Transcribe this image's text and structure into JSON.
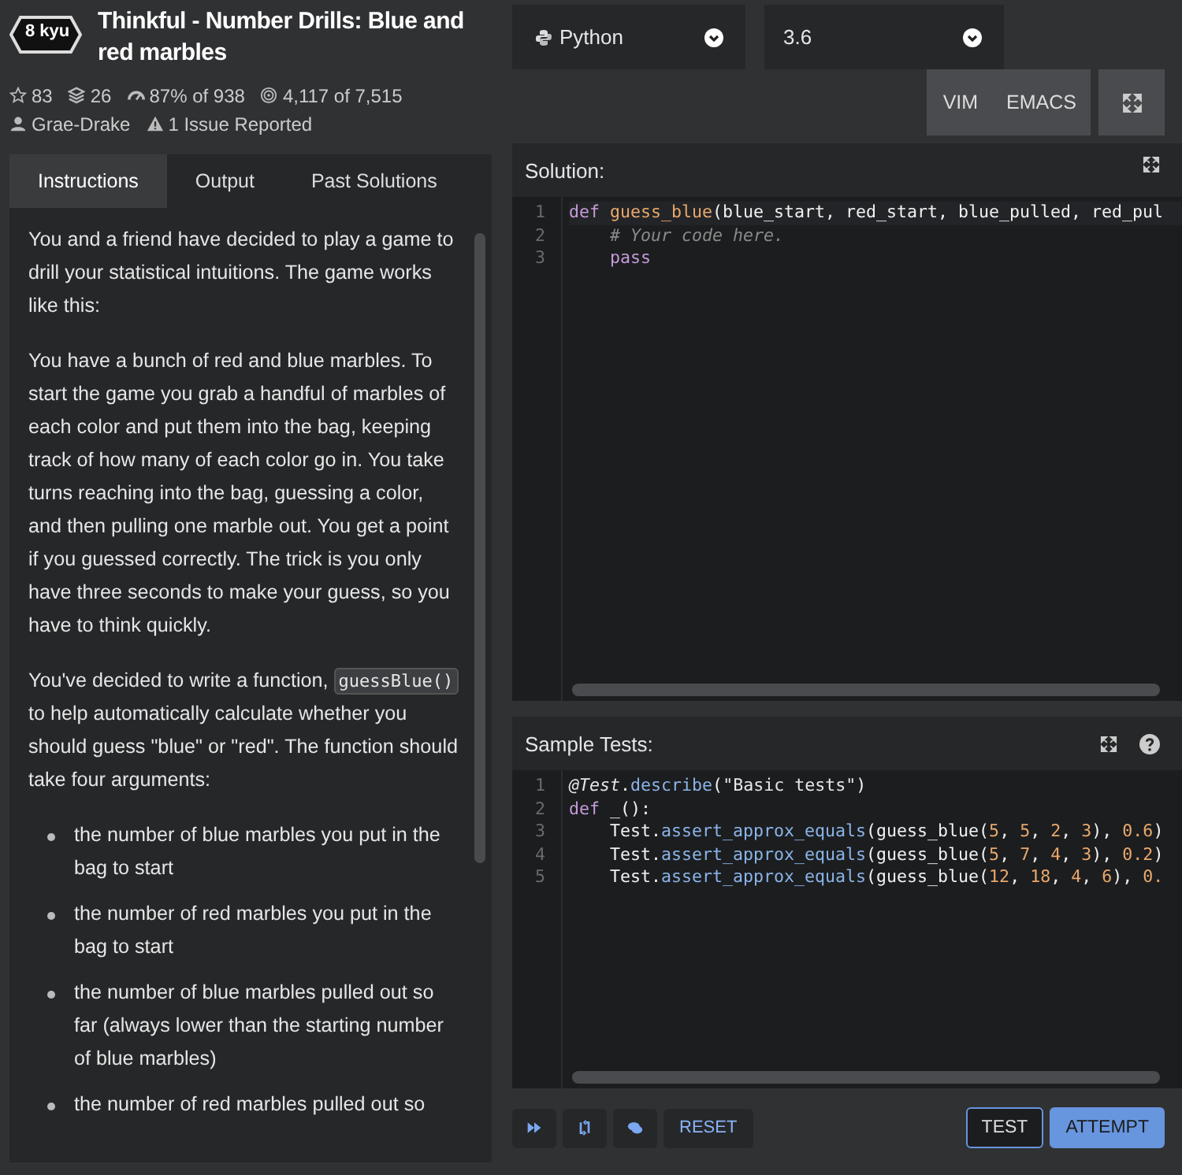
{
  "kata": {
    "rank": "8 kyu",
    "title": "Thinkful - Number Drills: Blue and red marbles",
    "stats": [
      {
        "kind": "stars",
        "text": "83"
      },
      {
        "kind": "collections",
        "text": "26"
      },
      {
        "kind": "satisfaction",
        "text": "87% of 938"
      },
      {
        "kind": "completions",
        "text": "4,117 of 7,515"
      },
      {
        "kind": "author",
        "text": "Grae-Drake"
      },
      {
        "kind": "issues",
        "text": "1 Issue Reported"
      }
    ]
  },
  "language_select": {
    "value": "Python"
  },
  "version_select": {
    "value": "3.6"
  },
  "editor_modes": [
    {
      "label": "VIM",
      "selected": false
    },
    {
      "label": "EMACS",
      "selected": false
    }
  ],
  "tabs": [
    {
      "label": "Instructions",
      "selected": true
    },
    {
      "label": "Output",
      "selected": false
    },
    {
      "label": "Past Solutions",
      "selected": false
    }
  ],
  "description": [
    {
      "kind": "paragraph",
      "parts": [
        {
          "kind": "text",
          "text": "You and a friend have decided to play a game to drill your statistical intuitions. The game works like this:"
        }
      ]
    },
    {
      "kind": "paragraph",
      "parts": [
        {
          "kind": "text",
          "text": "You have a bunch of red and blue marbles. To start the game you grab a handful of marbles of each color and put them into the bag, keeping track of how many of each color go in. You take turns reaching into the bag, guessing a color, and then pulling one marble out. You get a point if you guessed correctly. The trick is you only have three seconds to make your guess, so you have to think quickly."
        }
      ]
    },
    {
      "kind": "paragraph",
      "parts": [
        {
          "kind": "text",
          "text": "You've decided to write a function, "
        },
        {
          "kind": "code",
          "text": "guessBlue()"
        },
        {
          "kind": "text",
          "text": " to help automatically calculate whether you should guess \"blue\" or \"red\". The function should take four arguments:"
        }
      ]
    },
    {
      "kind": "bullet",
      "parts": [
        {
          "kind": "text",
          "text": "the number of blue marbles you put in the bag to start"
        }
      ]
    },
    {
      "kind": "bullet",
      "parts": [
        {
          "kind": "text",
          "text": "the number of red marbles you put in the bag to start"
        }
      ]
    },
    {
      "kind": "bullet",
      "parts": [
        {
          "kind": "text",
          "text": "the number of blue marbles pulled out so far (always lower than the starting number of blue marbles)"
        }
      ]
    },
    {
      "kind": "bullet",
      "parts": [
        {
          "kind": "text",
          "text": "the number of red marbles pulled out so"
        }
      ]
    }
  ],
  "solution": {
    "title": "Solution:",
    "lines": [
      {
        "number": "1",
        "tokens": [
          {
            "kind": "keyword",
            "text": "def "
          },
          {
            "kind": "function",
            "text": "guess_blue"
          },
          {
            "kind": "plain",
            "text": "(blue_start, red_start, blue_pulled, red_pul"
          }
        ]
      },
      {
        "number": "2",
        "tokens": [
          {
            "kind": "comment",
            "text": "    # Your code here."
          }
        ]
      },
      {
        "number": "3",
        "tokens": [
          {
            "kind": "keyword",
            "text": "    pass"
          }
        ]
      }
    ]
  },
  "sample_tests": {
    "title": "Sample Tests:",
    "lines": [
      {
        "number": "1",
        "tokens": [
          {
            "kind": "decorator",
            "text": "@Test"
          },
          {
            "kind": "plain",
            "text": "."
          },
          {
            "kind": "method",
            "text": "describe"
          },
          {
            "kind": "plain",
            "text": "("
          },
          {
            "kind": "string",
            "text": "\"Basic tests\""
          },
          {
            "kind": "plain",
            "text": ")"
          }
        ]
      },
      {
        "number": "2",
        "tokens": [
          {
            "kind": "keyword",
            "text": "def "
          },
          {
            "kind": "plain",
            "text": "_():"
          }
        ]
      },
      {
        "number": "3",
        "tokens": [
          {
            "kind": "plain",
            "text": "    Test."
          },
          {
            "kind": "method",
            "text": "assert_approx_equals"
          },
          {
            "kind": "plain",
            "text": "(guess_blue("
          },
          {
            "kind": "number",
            "text": "5"
          },
          {
            "kind": "plain",
            "text": ", "
          },
          {
            "kind": "number",
            "text": "5"
          },
          {
            "kind": "plain",
            "text": ", "
          },
          {
            "kind": "number",
            "text": "2"
          },
          {
            "kind": "plain",
            "text": ", "
          },
          {
            "kind": "number",
            "text": "3"
          },
          {
            "kind": "plain",
            "text": "), "
          },
          {
            "kind": "number",
            "text": "0.6"
          },
          {
            "kind": "plain",
            "text": ")"
          }
        ]
      },
      {
        "number": "4",
        "tokens": [
          {
            "kind": "plain",
            "text": "    Test."
          },
          {
            "kind": "method",
            "text": "assert_approx_equals"
          },
          {
            "kind": "plain",
            "text": "(guess_blue("
          },
          {
            "kind": "number",
            "text": "5"
          },
          {
            "kind": "plain",
            "text": ", "
          },
          {
            "kind": "number",
            "text": "7"
          },
          {
            "kind": "plain",
            "text": ", "
          },
          {
            "kind": "number",
            "text": "4"
          },
          {
            "kind": "plain",
            "text": ", "
          },
          {
            "kind": "number",
            "text": "3"
          },
          {
            "kind": "plain",
            "text": "), "
          },
          {
            "kind": "number",
            "text": "0.2"
          },
          {
            "kind": "plain",
            "text": ")"
          }
        ]
      },
      {
        "number": "5",
        "tokens": [
          {
            "kind": "plain",
            "text": "    Test."
          },
          {
            "kind": "method",
            "text": "assert_approx_equals"
          },
          {
            "kind": "plain",
            "text": "(guess_blue("
          },
          {
            "kind": "number",
            "text": "12"
          },
          {
            "kind": "plain",
            "text": ", "
          },
          {
            "kind": "number",
            "text": "18"
          },
          {
            "kind": "plain",
            "text": ", "
          },
          {
            "kind": "number",
            "text": "4"
          },
          {
            "kind": "plain",
            "text": ", "
          },
          {
            "kind": "number",
            "text": "6"
          },
          {
            "kind": "plain",
            "text": "), "
          },
          {
            "kind": "number",
            "text": "0."
          }
        ]
      }
    ]
  },
  "actions": [
    {
      "kind": "skip"
    },
    {
      "kind": "unlock"
    },
    {
      "kind": "discuss"
    },
    {
      "kind": "text",
      "label": "RESET"
    }
  ],
  "submit_buttons": [
    {
      "label": "TEST",
      "kind": "outline"
    },
    {
      "label": "ATTEMPT",
      "kind": "primary"
    }
  ]
}
